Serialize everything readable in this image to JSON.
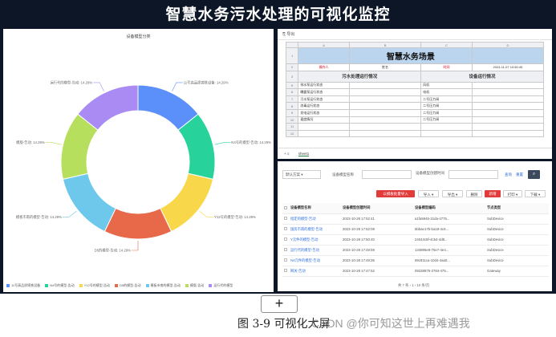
{
  "banner_title": "智慧水务污水处理的可视化监控",
  "chart_data": {
    "type": "pie",
    "title": "设备模型分类",
    "categories": [
      "11号高品质铸铁设备",
      "N4号的模型",
      "Y12号的模型",
      "D5的模型",
      "模板市南的模型",
      "模版",
      "运行代的模型"
    ],
    "labels": [
      "11号高品质铸铁设备: 14.29%",
      "N4号的模型-告动: 14.29%",
      "Y12号的模型-告动: 14.29%",
      "D5的模型-告动: 14.29%",
      "模板市南的模型-告动: 14.29%",
      "模版-告动: 14.29%",
      "运行代的模型-告动: 14.29%"
    ],
    "values": [
      14.29,
      14.29,
      14.29,
      14.29,
      14.29,
      14.29,
      14.29
    ],
    "colors": [
      "#5b8ff9",
      "#28d39b",
      "#f8d84a",
      "#e8684a",
      "#6dc8ec",
      "#b5df5c",
      "#a98bf3"
    ],
    "legend": [
      "11号高品质铸铁设备",
      "N4号的模型-告动",
      "Y12号的模型-告动",
      "D5的模型-告动",
      "模板市南的模型-告动",
      "模版-告动",
      "运行代的模型"
    ],
    "legend_position": "bottom"
  },
  "sheet": {
    "toolbar_label": "导出",
    "columns": [
      "A",
      "B",
      "C",
      "D"
    ],
    "title": "智慧水务场景",
    "r2": [
      "操作人",
      "姓名",
      "时间",
      "2023-11-07 10:50:45"
    ],
    "sec_left": "污水处理运行情况",
    "sec_right": "设备运行情况",
    "rows": [
      [
        "排水泵运行状态",
        "风机"
      ],
      [
        "曝露泵运行状态",
        "电机"
      ],
      [
        "污水泵运行状态",
        "二号压力阀"
      ],
      [
        "消毒运行状态",
        "二号压力阀"
      ],
      [
        "发电运行状态",
        "二号压力阀"
      ],
      [
        "速度情况",
        "二号压力阀"
      ]
    ],
    "tabs": [
      "sheet1"
    ]
  },
  "panel": {
    "query_select": "默认方案",
    "query_label1": "设备模型名称",
    "query_label2": "设备模型创建时间",
    "query_btn": "查询",
    "reset_btn": "重置",
    "toolbar": [
      "以模板批量导入",
      "导入",
      "导出",
      "删除",
      "新增",
      "打印",
      "下载"
    ],
    "headers": [
      "设备模型名称",
      "设备模型创建时间",
      "设备模型编码",
      "节点类型"
    ],
    "rows": [
      [
        "指定的模型-告动",
        "2023-10-28 17:52:41",
        "a1fa5945-31da-4775...",
        "SubDevice"
      ],
      [
        "国房市南的模型-告动",
        "2023-10-28 17:52:09",
        "5bbae17b-ba18-4c6...",
        "SubDevice"
      ],
      [
        "Y元件的模型-告动",
        "2023-10-28 17:50:40",
        "24043c8f-4c54-4d8...",
        "SubDevice"
      ],
      [
        "运行代的模型-告动",
        "2023-10-28 17:49:59",
        "134895e8-75e7-4e4...",
        "SubDevice"
      ],
      [
        "N4元件的模型-告动",
        "2023-10-28 17:49:36",
        "69c811ca-10d4-4aa0...",
        "SubDevice"
      ],
      [
        "网关-告动",
        "2023-10-28 17:47:52",
        "09238875-3784-475...",
        "Gateway"
      ]
    ],
    "pager": "共 7 条  ‹  1  ›  10 条/页"
  },
  "plus_label": "+",
  "caption": "图 3-9 可视化大屏",
  "watermark": "CSDN @你可知这世上再难遇我"
}
